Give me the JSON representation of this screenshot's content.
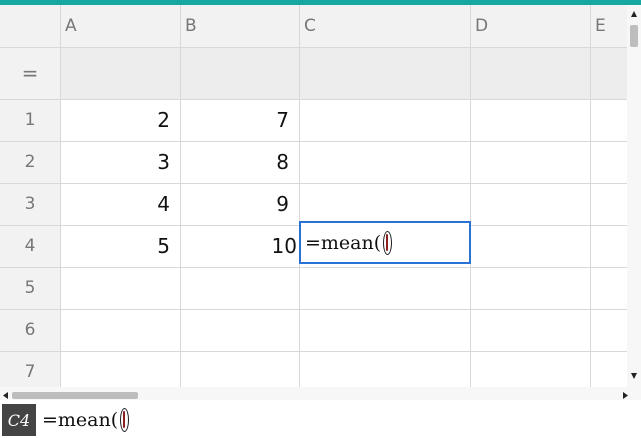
{
  "colors": {
    "accent": "#16a8a0",
    "selection": "#2b72d7"
  },
  "columns": [
    "A",
    "B",
    "C",
    "D",
    "E"
  ],
  "formula_row_label": "=",
  "rows": [
    {
      "label": "1",
      "a": "2",
      "b": "7"
    },
    {
      "label": "2",
      "a": "3",
      "b": "8"
    },
    {
      "label": "3",
      "a": "4",
      "b": "9"
    },
    {
      "label": "4",
      "a": "5",
      "b": "10"
    },
    {
      "label": "5",
      "a": "",
      "b": ""
    },
    {
      "label": "6",
      "a": "",
      "b": ""
    },
    {
      "label": "7",
      "a": "",
      "b": ""
    }
  ],
  "active_cell": {
    "ref": "C4",
    "content": "=mean("
  },
  "entry_line": {
    "ref": "C4",
    "content": "=mean("
  }
}
